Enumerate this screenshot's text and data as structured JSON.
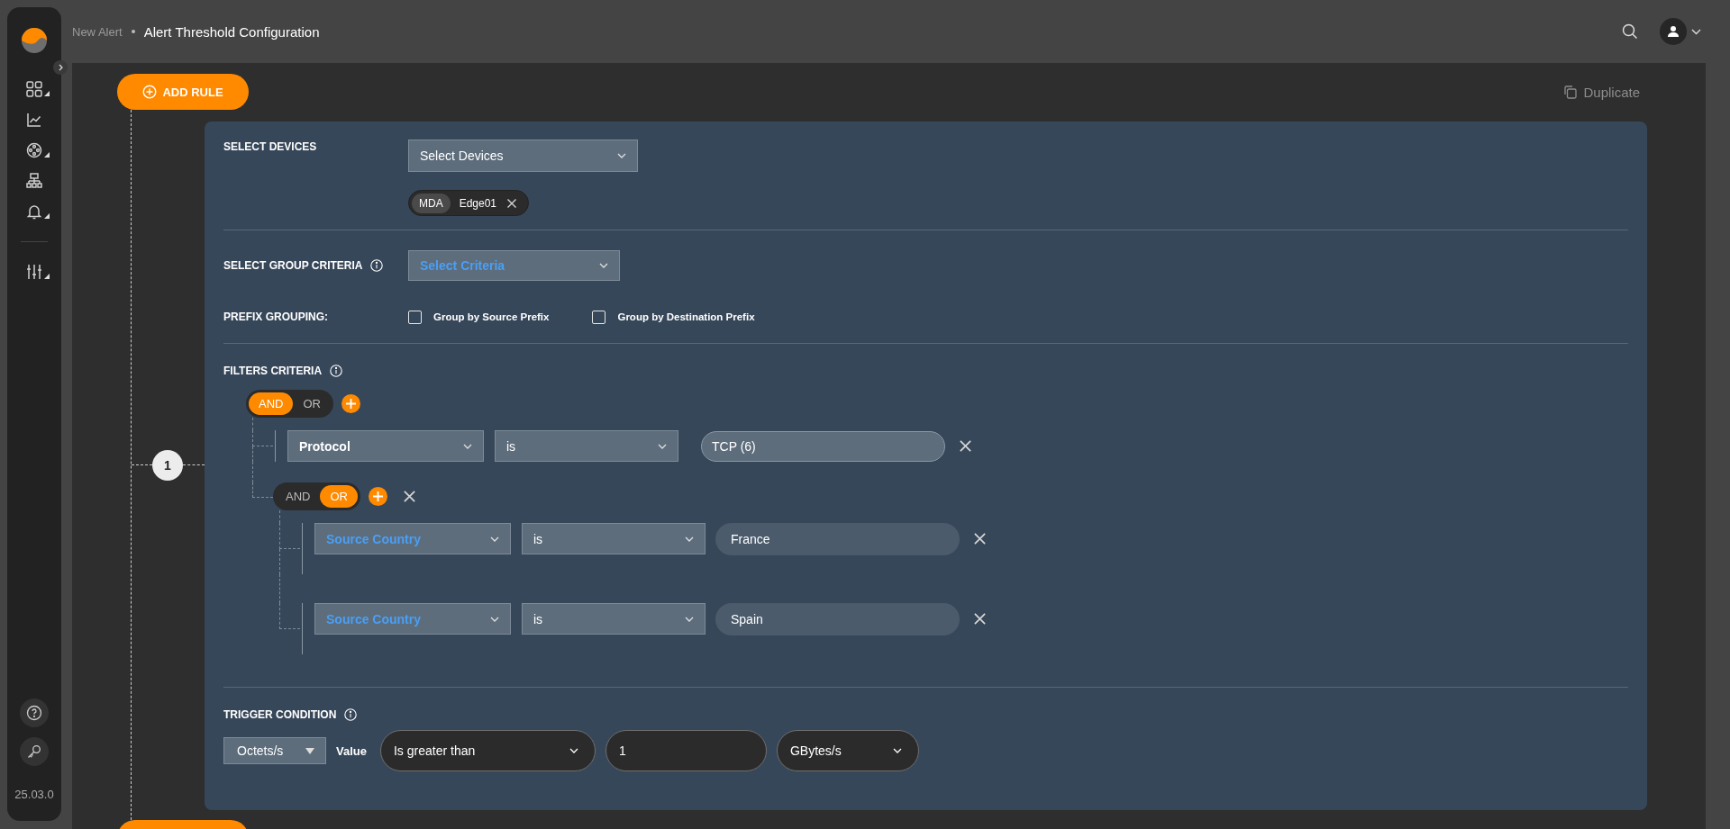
{
  "sidebar": {
    "items": [
      {
        "submenu": true
      },
      {
        "submenu": false
      },
      {
        "submenu": true
      },
      {
        "submenu": false
      },
      {
        "submenu": true
      },
      {
        "submenu": true
      }
    ],
    "version": "25.03.0"
  },
  "header": {
    "breadcrumb": [
      {
        "label": "New Alert",
        "current": false
      },
      {
        "label": "Alert Threshold Configuration",
        "current": true
      }
    ]
  },
  "toolbar": {
    "add_rule": "ADD RULE",
    "duplicate": "Duplicate"
  },
  "rule": {
    "number": "1",
    "devices": {
      "label": "SELECT DEVICES",
      "select": "Select Devices",
      "chips": [
        {
          "tag": "MDA",
          "name": "Edge01"
        }
      ]
    },
    "group_criteria": {
      "label": "SELECT GROUP CRITERIA",
      "select": "Select Criteria",
      "accent": true
    },
    "prefix_grouping": {
      "label": "PREFIX GROUPING:",
      "options": [
        {
          "label": "Group by Source Prefix",
          "checked": false
        },
        {
          "label": "Group by Destination Prefix",
          "checked": false
        }
      ]
    },
    "filters": {
      "label": "FILTERS CRITERIA",
      "root": {
        "operators": [
          {
            "label": "AND",
            "selected": true
          },
          {
            "label": "OR",
            "selected": false
          }
        ],
        "children": [
          {
            "kind": "condition",
            "field": "Protocol",
            "accent": false,
            "operator": "is",
            "value": "TCP (6)",
            "outlined": true
          },
          {
            "kind": "group",
            "operators": [
              {
                "label": "AND",
                "selected": false
              },
              {
                "label": "OR",
                "selected": true
              }
            ],
            "removable": true,
            "children": [
              {
                "kind": "condition",
                "field": "Source Country",
                "accent": true,
                "operator": "is",
                "value": "France",
                "outlined": false
              },
              {
                "kind": "condition",
                "field": "Source Country",
                "accent": true,
                "operator": "is",
                "value": "Spain",
                "outlined": false
              }
            ]
          }
        ]
      }
    },
    "trigger": {
      "label": "TRIGGER CONDITION",
      "metric": "Octets/s",
      "value_label": "Value",
      "comparison": "Is greater than",
      "amount": "1",
      "unit": "GBytes/s"
    }
  }
}
